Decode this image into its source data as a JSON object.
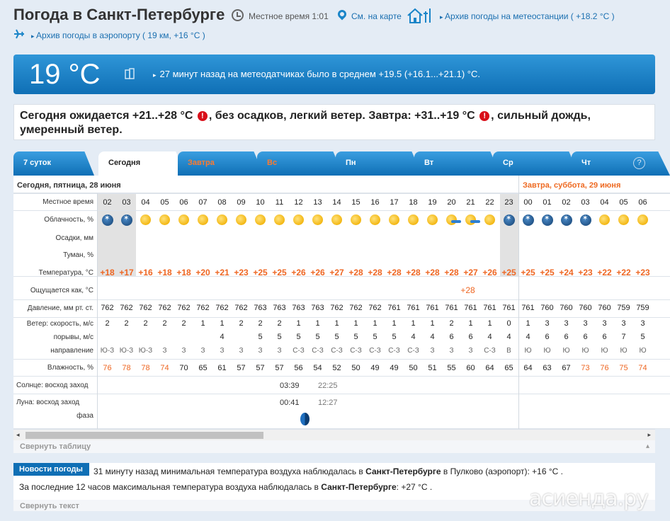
{
  "header": {
    "title": "Погода в Санкт-Петербурге",
    "local_time": "Местное время  1:01",
    "map_link": "См. на карте",
    "station_archive": "Архив погоды на метеостанции ( +18.2 °C )",
    "airport_archive": "Архив погоды в аэропорту ( 19 км, +16 °C )"
  },
  "current": {
    "temp": "19 °C",
    "note": "27 минут назад на метеодатчиках было в среднем +19.5 (+16.1...+21.1) °C."
  },
  "summary": {
    "part1": "Сегодня ожидается +21..+28 °C",
    "part2": ", без осадков, легкий ветер. Завтра: +31..+19 °C",
    "part3": ", сильный дождь, умеренный ветер.",
    "warn_glyph": "!"
  },
  "tabs": [
    {
      "label": "7 суток"
    },
    {
      "label": "Сегодня"
    },
    {
      "label": "Завтра"
    },
    {
      "label": "Вс"
    },
    {
      "label": "Пн"
    },
    {
      "label": "Вт"
    },
    {
      "label": "Ср"
    },
    {
      "label": "Чт"
    }
  ],
  "help_glyph": "?",
  "table": {
    "today_date": "Сегодня, пятница, 28 июня",
    "tomorrow_date": "Завтра, суббота, 29 июня",
    "labels": {
      "time": "Местное время",
      "cloud": "Облачность, %",
      "precip": "Осадки, мм",
      "fog": "Туман, %",
      "temp": "Температура, °C",
      "feels": "Ощущается как, °C",
      "pressure": "Давление, мм рт. ст.",
      "wind_speed": "Ветер: скорость, м/с",
      "gusts": "порывы, м/с",
      "direction": "направление",
      "humidity": "Влажность, %",
      "sun": "Солнце: восход заход",
      "moon": "Луна: восход заход",
      "phase": "фаза"
    },
    "hours": [
      "02",
      "03",
      "04",
      "05",
      "06",
      "07",
      "08",
      "09",
      "10",
      "11",
      "12",
      "13",
      "14",
      "15",
      "16",
      "17",
      "18",
      "19",
      "20",
      "21",
      "22",
      "23",
      "00",
      "01",
      "02",
      "03",
      "04",
      "05",
      "06"
    ],
    "cloud_icons": [
      "moon-night",
      "moon-night",
      "sun",
      "sun",
      "sun",
      "sun",
      "sun",
      "sun",
      "sun",
      "sun",
      "sun",
      "sun",
      "sun",
      "sun",
      "sun",
      "sun",
      "sun",
      "sun",
      "sun-cloud",
      "sun-cloud",
      "sun",
      "moon-night",
      "moon-night",
      "moon-night",
      "moon-night",
      "moon-night",
      "sun",
      "sun",
      "sun"
    ],
    "temps": [
      "+18",
      "+17",
      "+16",
      "+18",
      "+18",
      "+20",
      "+21",
      "+23",
      "+25",
      "+25",
      "+26",
      "+26",
      "+27",
      "+28",
      "+28",
      "+28",
      "+28",
      "+28",
      "+28",
      "+27",
      "+26",
      "+25",
      "+25",
      "+25",
      "+24",
      "+23",
      "+22",
      "+22",
      "+23"
    ],
    "feels": [
      "",
      "",
      "",
      "",
      "",
      "",
      "",
      "",
      "",
      "",
      "",
      "",
      "",
      "",
      "",
      "",
      "",
      "",
      "",
      "+28",
      "",
      "",
      "",
      "",
      "",
      "",
      "",
      "",
      ""
    ],
    "pressure": [
      "762",
      "762",
      "762",
      "762",
      "762",
      "762",
      "762",
      "762",
      "763",
      "763",
      "763",
      "763",
      "762",
      "762",
      "762",
      "761",
      "761",
      "761",
      "761",
      "761",
      "761",
      "761",
      "761",
      "760",
      "760",
      "760",
      "760",
      "759",
      "759"
    ],
    "wind": [
      "2",
      "2",
      "2",
      "2",
      "2",
      "1",
      "1",
      "2",
      "2",
      "2",
      "1",
      "1",
      "1",
      "1",
      "1",
      "1",
      "1",
      "1",
      "2",
      "1",
      "1",
      "0",
      "1",
      "3",
      "3",
      "3",
      "3",
      "3",
      "3"
    ],
    "gusts": [
      "",
      "",
      "",
      "",
      "",
      "",
      "4",
      "",
      "5",
      "5",
      "5",
      "5",
      "5",
      "5",
      "5",
      "5",
      "4",
      "4",
      "6",
      "6",
      "4",
      "4",
      "4",
      "6",
      "6",
      "6",
      "6",
      "7",
      "5"
    ],
    "directions": [
      "Ю-З",
      "Ю-З",
      "Ю-З",
      "З",
      "З",
      "З",
      "З",
      "З",
      "З",
      "З",
      "С-З",
      "С-З",
      "С-З",
      "С-З",
      "С-З",
      "С-З",
      "С-З",
      "З",
      "З",
      "З",
      "С-З",
      "В",
      "Ю",
      "Ю",
      "Ю",
      "Ю",
      "Ю",
      "Ю",
      "Ю"
    ],
    "humidity": [
      "76",
      "78",
      "78",
      "74",
      "70",
      "65",
      "61",
      "57",
      "57",
      "57",
      "56",
      "54",
      "52",
      "50",
      "49",
      "49",
      "50",
      "51",
      "55",
      "60",
      "64",
      "65",
      "64",
      "63",
      "67",
      "73",
      "76",
      "75",
      "74"
    ],
    "sunrise": "03:39",
    "sunset": "22:25",
    "moonrise": "00:41",
    "moonset": "12:27"
  },
  "collapse_table": "Свернуть таблицу",
  "news": {
    "badge": "Новости погоды",
    "line1_a": "31 минуту назад минимальная температура воздуха наблюдалась в ",
    "line1_b": "Санкт-Петербурге",
    "line1_c": " в Пулково (аэропорт): +16 °C .",
    "line2_a": "За последние 12 часов максимальная температура воздуха наблюдалась в ",
    "line2_b": "Санкт-Петербурге",
    "line2_c": ": +27 °C ."
  },
  "collapse_text": "Свернуть текст",
  "watermark": "асиенда.ру",
  "colors": {
    "accent": "#0f6fb5",
    "warm": "#ee6622",
    "warning": "#d9101a"
  }
}
